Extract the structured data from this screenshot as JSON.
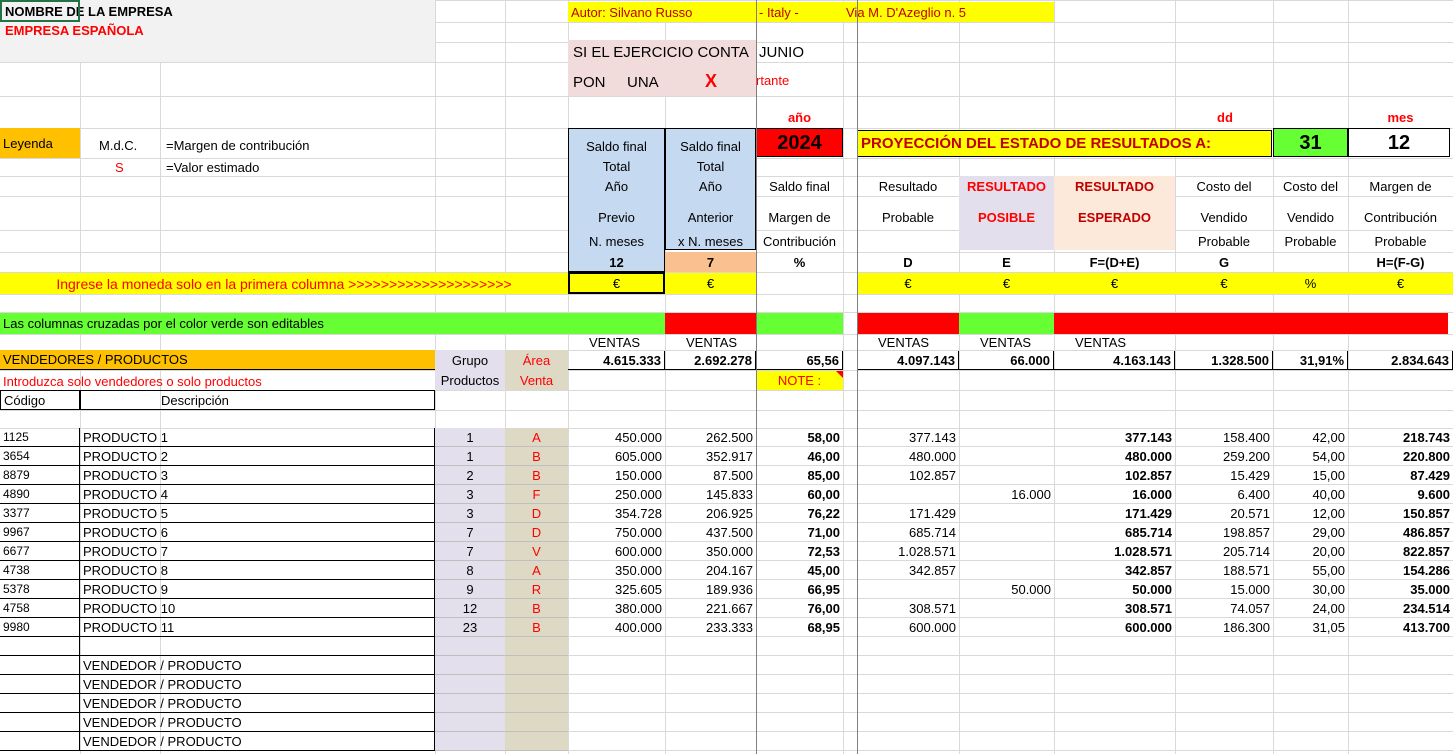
{
  "company": {
    "name": "NOMBRE DE LA EMPRESA",
    "sub": "EMPRESA ESPAÑOLA"
  },
  "author": {
    "label": "Autor: Silvano Russo",
    "country": "- Italy -",
    "address": "Via M. D'Azeglio n. 5"
  },
  "notice": {
    "line1": "SI EL EJERCICIO CONTA",
    "line1b": "JUNIO",
    "pon": "PON",
    "una": "UNA",
    "x": "X",
    "tante": "rtante"
  },
  "legend": {
    "label": "Leyenda",
    "mdc": "M.d.C.",
    "mdc_desc": "=Margen de contribución",
    "s": "S",
    "s_desc": "=Valor estimado"
  },
  "date": {
    "anio_label": "año",
    "anio": "2024",
    "dd_label": "dd",
    "dd": "31",
    "mes_label": "mes",
    "mes": "12"
  },
  "projection_title": "PROYECCIÓN DEL ESTADO DE RESULTADOS A:",
  "columns": {
    "saldo_previo": {
      "l1": "Saldo final",
      "l2": "Total",
      "l3": "Año",
      "l4": "Previo",
      "l5": "N. meses",
      "code": "12",
      "cur": "€"
    },
    "saldo_anterior": {
      "l1": "Saldo final",
      "l2": "Total",
      "l3": "Año",
      "l4": "Anterior",
      "l5": "x N. meses",
      "code": "7",
      "cur": "€"
    },
    "margen": {
      "l1": "Saldo final",
      "l2": "Margen de",
      "l3": "Contribución",
      "code": "%"
    },
    "probable": {
      "l1": "Resultado",
      "l2": "Probable",
      "code": "D",
      "cur": "€"
    },
    "posible": {
      "l1": "RESULTADO",
      "l2": "POSIBLE",
      "code": "E",
      "cur": "€"
    },
    "esperado": {
      "l1": "RESULTADO",
      "l2": "ESPERADO",
      "code": "F=(D+E)",
      "cur": "€"
    },
    "costo1": {
      "l1": "Costo del",
      "l2": "Vendido",
      "l3": "Probable",
      "code": "G",
      "cur": "€"
    },
    "costo2": {
      "l1": "Costo del",
      "l2": "Vendido",
      "l3": "Probable",
      "cur": "%"
    },
    "mcontrib": {
      "l1": "Margen de",
      "l2": "Contribución",
      "l3": "Probable",
      "code": "H=(F-G)",
      "cur": "€"
    }
  },
  "currency_prompt": "Ingrese la moneda solo en la primera columna >>>>>>>>>>>>>>>>>>>>",
  "editable_note": "Las columnas cruzadas por el color verde son editables",
  "ventas_label": "VENTAS",
  "vendors_header": "VENDEDORES / PRODUCTOS",
  "grupo_l1": "Grupo",
  "grupo_l2": "Productos",
  "area_l1": "Área",
  "area_l2": "Venta",
  "intro_note": "Introduzca solo vendedores o solo productos",
  "codigo": "Código",
  "descripcion": "Descripción",
  "note_label": "NOTE :",
  "totals": {
    "previo": "4.615.333",
    "anterior": "2.692.278",
    "margen": "65,56",
    "probable": "4.097.143",
    "posible": "66.000",
    "esperado": "4.163.143",
    "costo": "1.328.500",
    "costo_pct": "31,91%",
    "mcontrib": "2.834.643"
  },
  "rows": [
    {
      "code": "1125",
      "desc": "PRODUCTO 1",
      "grupo": "1",
      "area": "A",
      "previo": "450.000",
      "anterior": "262.500",
      "margen": "58,00",
      "probable": "377.143",
      "posible": "",
      "esperado": "377.143",
      "costo": "158.400",
      "pct": "42,00",
      "mc": "218.743"
    },
    {
      "code": "3654",
      "desc": "PRODUCTO 2",
      "grupo": "1",
      "area": "B",
      "previo": "605.000",
      "anterior": "352.917",
      "margen": "46,00",
      "probable": "480.000",
      "posible": "",
      "esperado": "480.000",
      "costo": "259.200",
      "pct": "54,00",
      "mc": "220.800"
    },
    {
      "code": "8879",
      "desc": "PRODUCTO 3",
      "grupo": "2",
      "area": "B",
      "previo": "150.000",
      "anterior": "87.500",
      "margen": "85,00",
      "probable": "102.857",
      "posible": "",
      "esperado": "102.857",
      "costo": "15.429",
      "pct": "15,00",
      "mc": "87.429"
    },
    {
      "code": "4890",
      "desc": "PRODUCTO 4",
      "grupo": "3",
      "area": "F",
      "previo": "250.000",
      "anterior": "145.833",
      "margen": "60,00",
      "probable": "",
      "posible": "16.000",
      "esperado": "16.000",
      "costo": "6.400",
      "pct": "40,00",
      "mc": "9.600"
    },
    {
      "code": "3377",
      "desc": "PRODUCTO 5",
      "grupo": "3",
      "area": "D",
      "previo": "354.728",
      "anterior": "206.925",
      "margen": "76,22",
      "probable": "171.429",
      "posible": "",
      "esperado": "171.429",
      "costo": "20.571",
      "pct": "12,00",
      "mc": "150.857"
    },
    {
      "code": "9967",
      "desc": "PRODUCTO 6",
      "grupo": "7",
      "area": "D",
      "previo": "750.000",
      "anterior": "437.500",
      "margen": "71,00",
      "probable": "685.714",
      "posible": "",
      "esperado": "685.714",
      "costo": "198.857",
      "pct": "29,00",
      "mc": "486.857"
    },
    {
      "code": "6677",
      "desc": "PRODUCTO 7",
      "grupo": "7",
      "area": "V",
      "previo": "600.000",
      "anterior": "350.000",
      "margen": "72,53",
      "probable": "1.028.571",
      "posible": "",
      "esperado": "1.028.571",
      "costo": "205.714",
      "pct": "20,00",
      "mc": "822.857"
    },
    {
      "code": "4738",
      "desc": "PRODUCTO 8",
      "grupo": "8",
      "area": "A",
      "previo": "350.000",
      "anterior": "204.167",
      "margen": "45,00",
      "probable": "342.857",
      "posible": "",
      "esperado": "342.857",
      "costo": "188.571",
      "pct": "55,00",
      "mc": "154.286"
    },
    {
      "code": "5378",
      "desc": "PRODUCTO 9",
      "grupo": "9",
      "area": "R",
      "previo": "325.605",
      "anterior": "189.936",
      "margen": "66,95",
      "probable": "",
      "posible": "50.000",
      "esperado": "50.000",
      "costo": "15.000",
      "pct": "30,00",
      "mc": "35.000"
    },
    {
      "code": "4758",
      "desc": "PRODUCTO 10",
      "grupo": "12",
      "area": "B",
      "previo": "380.000",
      "anterior": "221.667",
      "margen": "76,00",
      "probable": "308.571",
      "posible": "",
      "esperado": "308.571",
      "costo": "74.057",
      "pct": "24,00",
      "mc": "234.514"
    },
    {
      "code": "9980",
      "desc": "PRODUCTO 11",
      "grupo": "23",
      "area": "B",
      "previo": "400.000",
      "anterior": "233.333",
      "margen": "68,95",
      "probable": "600.000",
      "posible": "",
      "esperado": "600.000",
      "costo": "186.300",
      "pct": "31,05",
      "mc": "413.700"
    }
  ],
  "placeholders": [
    "VENDEDOR / PRODUCTO",
    "VENDEDOR / PRODUCTO",
    "VENDEDOR / PRODUCTO",
    "VENDEDOR / PRODUCTO",
    "VENDEDOR / PRODUCTO"
  ]
}
